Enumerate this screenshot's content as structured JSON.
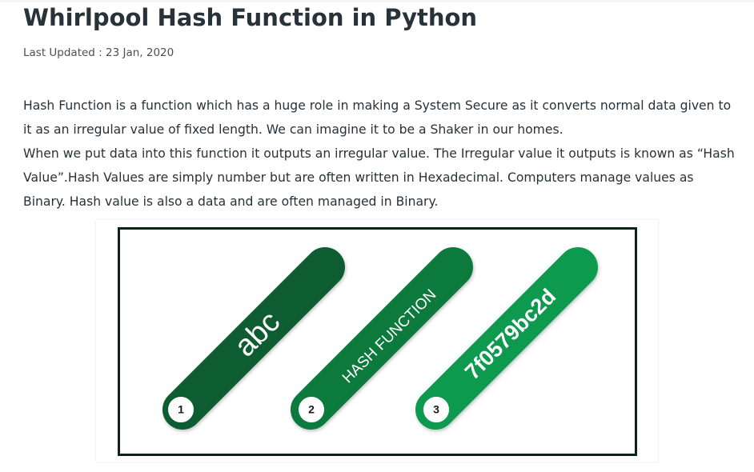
{
  "article": {
    "title": "Whirlpool Hash Function in Python",
    "last_updated": "Last Updated : 23 Jan, 2020",
    "paragraphs": [
      "Hash Function is a function which has a huge role in making a System Secure as it converts normal data given to it as an irregular value of fixed length. We can imagine it to be a Shaker in our homes.",
      "When we put data into this function it outputs an irregular value. The Irregular value it outputs is known as “Hash Value”.Hash Values are simply number but are often written in Hexadecimal. Computers manage values as Binary. Hash value is also a data and are often managed in Binary."
    ]
  },
  "figure": {
    "pills": [
      {
        "step": "1",
        "text": "abc",
        "color": "#0a5c31"
      },
      {
        "step": "2",
        "text": "HASH FUNCTION",
        "color": "#0b7a3e"
      },
      {
        "step": "3",
        "text": "7f0579bc2d",
        "color": "#0f9a50"
      }
    ],
    "border_color": "#0b2414"
  }
}
